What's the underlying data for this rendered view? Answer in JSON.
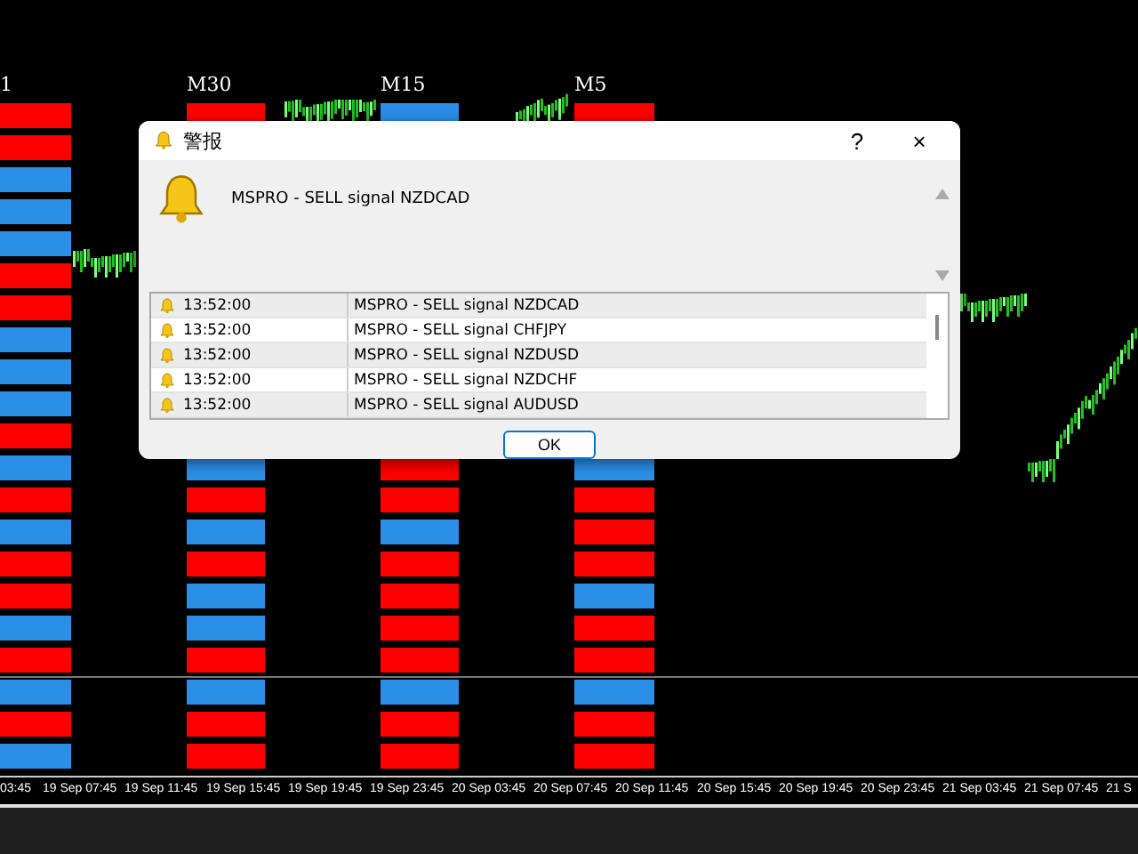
{
  "chart": {
    "columns": [
      {
        "label": "1",
        "cells_top": [
          {
            "color": "#ff0000"
          },
          {
            "color": "#ff0000"
          },
          {
            "color": "#2b8fe8"
          },
          {
            "color": "#2b8fe8"
          },
          {
            "color": "#2b8fe8"
          },
          {
            "color": "#ff0000"
          },
          {
            "color": "#ff0000"
          },
          {
            "color": "#2b8fe8"
          },
          {
            "color": "#2b8fe8"
          },
          {
            "color": "#2b8fe8"
          },
          {
            "color": "#ff0000"
          },
          {
            "color": "#2b8fe8"
          },
          {
            "color": "#ff0000"
          },
          {
            "color": "#2b8fe8"
          },
          {
            "color": "#ff0000"
          },
          {
            "color": "#ff0000"
          },
          {
            "color": "#2b8fe8"
          },
          {
            "color": "#ff0000"
          },
          {
            "color": "#2b8fe8"
          },
          {
            "color": "#ff0000"
          },
          {
            "color": "#2b8fe8"
          }
        ]
      },
      {
        "label": "M30",
        "cells_top": [
          {
            "color": "#ff0000"
          }
        ],
        "cells_bottom": [
          {
            "color": "#2b8fe8"
          },
          {
            "color": "#ff0000"
          },
          {
            "color": "#2b8fe8"
          },
          {
            "color": "#ff0000"
          },
          {
            "color": "#2b8fe8"
          },
          {
            "color": "#2b8fe8"
          },
          {
            "color": "#ff0000"
          },
          {
            "color": "#2b8fe8"
          },
          {
            "color": "#ff0000"
          },
          {
            "color": "#ff0000"
          }
        ]
      },
      {
        "label": "M15",
        "cells_top": [
          {
            "color": "#2b8fe8"
          }
        ],
        "cells_bottom": [
          {
            "color": "#ff0000"
          },
          {
            "color": "#ff0000"
          },
          {
            "color": "#2b8fe8"
          },
          {
            "color": "#ff0000"
          },
          {
            "color": "#ff0000"
          },
          {
            "color": "#ff0000"
          },
          {
            "color": "#ff0000"
          },
          {
            "color": "#2b8fe8"
          },
          {
            "color": "#ff0000"
          },
          {
            "color": "#ff0000"
          }
        ]
      },
      {
        "label": "M5",
        "cells_top": [
          {
            "color": "#ff0000"
          }
        ],
        "cells_bottom": [
          {
            "color": "#2b8fe8"
          },
          {
            "color": "#ff0000"
          },
          {
            "color": "#ff0000"
          },
          {
            "color": "#ff0000"
          },
          {
            "color": "#2b8fe8"
          },
          {
            "color": "#ff0000"
          },
          {
            "color": "#ff0000"
          },
          {
            "color": "#2b8fe8"
          },
          {
            "color": "#ff0000"
          },
          {
            "color": "#ff0000"
          }
        ]
      }
    ],
    "time_axis": [
      "03:45",
      "19 Sep 07:45",
      "19 Sep 11:45",
      "19 Sep 15:45",
      "19 Sep 19:45",
      "19 Sep 23:45",
      "20 Sep 03:45",
      "20 Sep 07:45",
      "20 Sep 11:45",
      "20 Sep 15:45",
      "20 Sep 19:45",
      "20 Sep 23:45",
      "21 Sep 03:45",
      "21 Sep 07:45",
      "21 S"
    ]
  },
  "dialog": {
    "title": "警报",
    "help": "?",
    "close": "×",
    "message": "MSPRO - SELL signal NZDCAD",
    "rows": [
      {
        "time": "13:52:00",
        "text": "MSPRO - SELL signal NZDCAD"
      },
      {
        "time": "13:52:00",
        "text": "MSPRO - SELL signal CHFJPY"
      },
      {
        "time": "13:52:00",
        "text": "MSPRO - SELL signal NZDUSD"
      },
      {
        "time": "13:52:00",
        "text": "MSPRO - SELL signal NZDCHF"
      },
      {
        "time": "13:52:00",
        "text": "MSPRO - SELL signal AUDUSD"
      }
    ],
    "ok": "OK"
  }
}
